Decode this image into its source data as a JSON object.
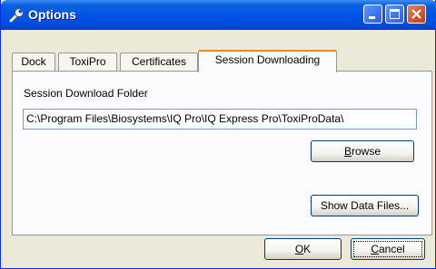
{
  "window": {
    "title": "Options",
    "title_icon": "wrench-icon",
    "controls": [
      "minimize-icon",
      "maximize-icon",
      "close-icon"
    ]
  },
  "tabs": [
    {
      "label": "Dock",
      "active": false
    },
    {
      "label": "ToxiPro",
      "active": false
    },
    {
      "label": "Certificates",
      "active": false
    },
    {
      "label": "Session Downloading",
      "active": true
    }
  ],
  "session": {
    "folder_label": "Session Download Folder",
    "folder_value": "C:\\Program Files\\Biosystems\\IQ Pro\\IQ Express Pro\\ToxiProData\\",
    "browse_mnemonic": "B",
    "browse_rest": "rowse",
    "show_data_files_label": "Show Data Files..."
  },
  "footer": {
    "ok_mnemonic": "O",
    "ok_rest": "K",
    "cancel_mnemonic": "C",
    "cancel_rest": "ancel"
  },
  "colors": {
    "titlebar": "#0055e5",
    "face": "#ece9d8",
    "tab_highlight": "#e68b2c"
  }
}
